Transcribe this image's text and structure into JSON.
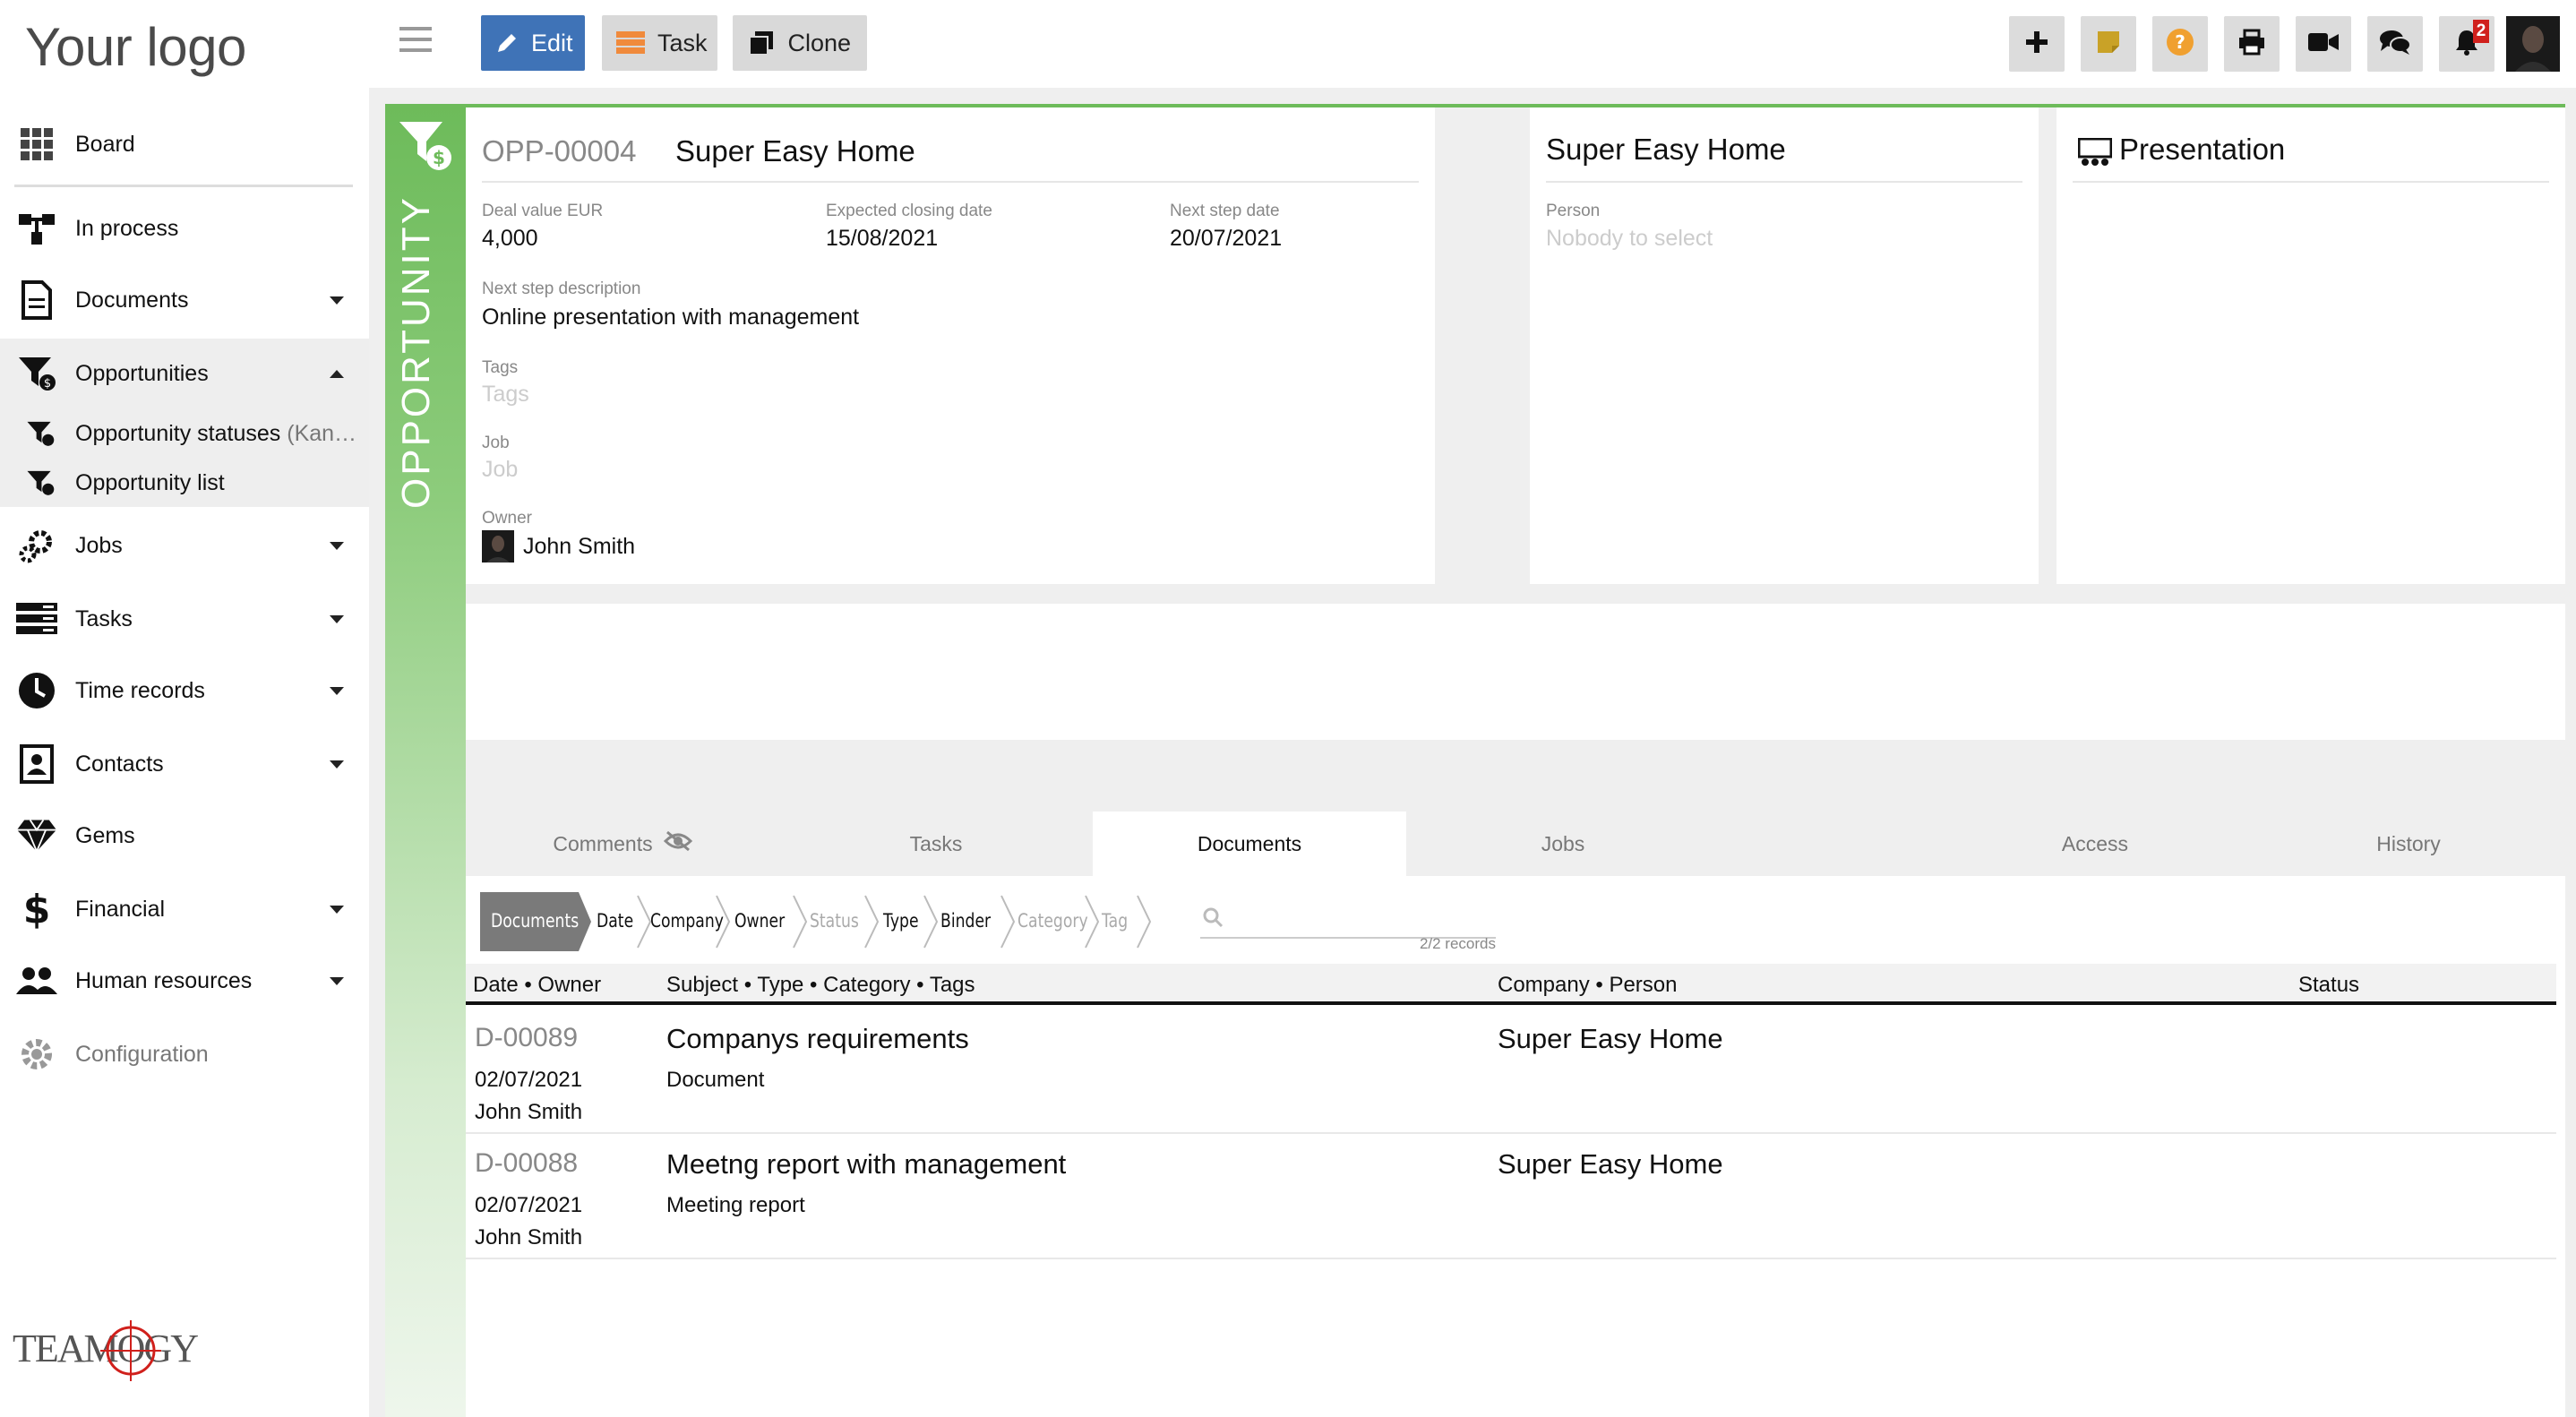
{
  "sidebar": {
    "logo": "Your logo",
    "items": [
      {
        "label": "Board",
        "icon": "grid-icon"
      },
      {
        "label": "In process",
        "icon": "process-icon"
      },
      {
        "label": "Documents",
        "icon": "document-icon"
      },
      {
        "label": "Opportunities",
        "icon": "funnel-dollar-icon"
      },
      {
        "label": "Opportunity statuses",
        "suffix": "(Kan…",
        "icon": "funnel-dollar-icon"
      },
      {
        "label": "Opportunity list",
        "icon": "funnel-dollar-icon"
      },
      {
        "label": "Jobs",
        "icon": "gears-icon"
      },
      {
        "label": "Tasks",
        "icon": "tasks-icon"
      },
      {
        "label": "Time records",
        "icon": "clock-icon"
      },
      {
        "label": "Contacts",
        "icon": "contact-card-icon"
      },
      {
        "label": "Gems",
        "icon": "diamond-icon"
      },
      {
        "label": "Financial",
        "icon": "dollar-icon"
      },
      {
        "label": "Human resources",
        "icon": "people-icon"
      },
      {
        "label": "Configuration",
        "icon": "gear-icon"
      }
    ],
    "brand": "TEAMOGY"
  },
  "toolbar": {
    "edit_label": "Edit",
    "task_label": "Task",
    "clone_label": "Clone",
    "notification_count": "2"
  },
  "opportunity": {
    "strip_label": "OPPORTUNITY",
    "id": "OPP-00004",
    "name": "Super Easy Home",
    "deal_value_label": "Deal value EUR",
    "deal_value": "4,000",
    "closing_label": "Expected closing date",
    "closing": "15/08/2021",
    "next_step_date_label": "Next step date",
    "next_step_date": "20/07/2021",
    "next_step_desc_label": "Next step description",
    "next_step_desc": "Online presentation with management",
    "tags_label": "Tags",
    "tags_placeholder": "Tags",
    "job_label": "Job",
    "job_placeholder": "Job",
    "owner_label": "Owner",
    "owner": "John Smith"
  },
  "company_card": {
    "title": "Super Easy Home",
    "person_label": "Person",
    "person_placeholder": "Nobody to select"
  },
  "presentation_card": {
    "title": "Presentation"
  },
  "tabs": [
    {
      "label": "Comments"
    },
    {
      "label": "Tasks"
    },
    {
      "label": "Documents"
    },
    {
      "label": "Jobs"
    },
    {
      "label": "Access"
    },
    {
      "label": "History"
    }
  ],
  "filters": {
    "crumbs": [
      "Documents",
      "Date",
      "Company",
      "Owner",
      "Status",
      "Type",
      "Binder",
      "Category",
      "Tag"
    ],
    "record_count": "2/2 records"
  },
  "table": {
    "headers": [
      "Date • Owner",
      "Subject • Type • Category • Tags",
      "Company • Person",
      "Status"
    ],
    "rows": [
      {
        "id": "D-00089",
        "date": "02/07/2021",
        "owner": "John Smith",
        "subject": "Companys requirements",
        "type": "Document",
        "company": "Super Easy Home"
      },
      {
        "id": "D-00088",
        "date": "02/07/2021",
        "owner": "John Smith",
        "subject": "Meetng report with management",
        "type": "Meeting report",
        "company": "Super Easy Home"
      }
    ]
  },
  "colors": {
    "accent_green": "#6dbb5a",
    "edit_blue": "#3f73b7",
    "badge_red": "#d0201c",
    "help_orange": "#f0a030",
    "note_yellow": "#c9a227"
  }
}
